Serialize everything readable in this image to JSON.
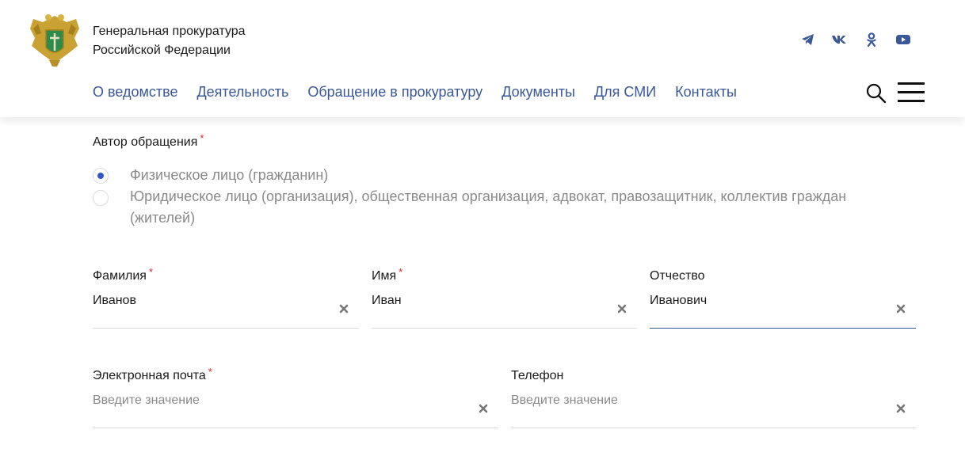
{
  "header": {
    "org_name_line1": "Генеральная прокуратура",
    "org_name_line2": "Российской Федерации",
    "socials": [
      "telegram-icon",
      "vk-icon",
      "odnoklassniki-icon",
      "youtube-icon"
    ],
    "accent_color": "#3a5897"
  },
  "nav": {
    "items": [
      "О ведомстве",
      "Деятельность",
      "Обращение в прокуратуру",
      "Документы",
      "Для СМИ",
      "Контакты"
    ]
  },
  "form": {
    "author_label": "Автор обращения",
    "required_mark": "*",
    "radio_options": [
      {
        "label": "Физическое лицо (гражданин)",
        "checked": true
      },
      {
        "label": "Юридическое лицо (организация), общественная организация, адвокат, правозащитник, коллектив граждан (жителей)",
        "checked": false
      }
    ],
    "last_name": {
      "label": "Фамилия",
      "value": "Иванов"
    },
    "first_name": {
      "label": "Имя",
      "value": "Иван"
    },
    "patronymic": {
      "label": "Отчество",
      "value": "Иванович"
    },
    "email": {
      "label": "Электронная почта",
      "value": "",
      "placeholder": "Введите значение"
    },
    "phone": {
      "label": "Телефон",
      "value": "",
      "placeholder": "Введите значение"
    }
  }
}
